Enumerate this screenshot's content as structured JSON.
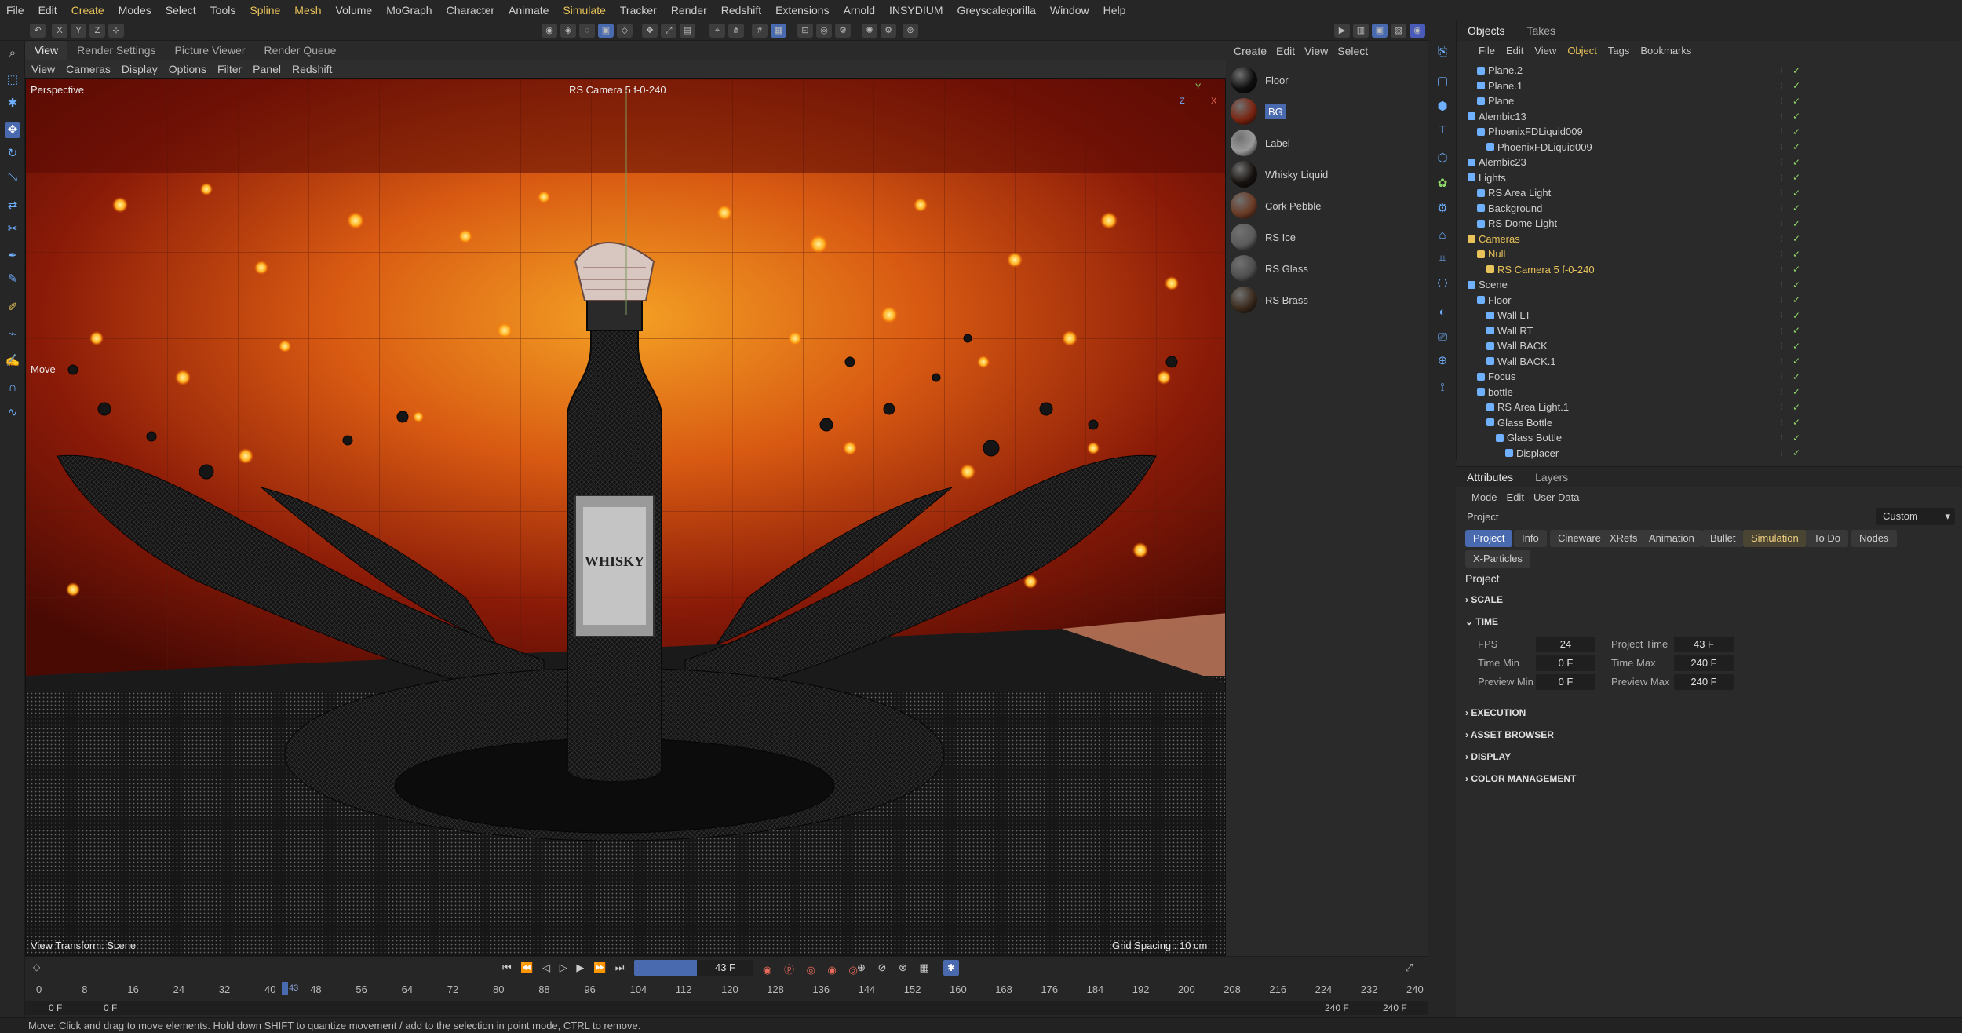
{
  "menu": [
    "File",
    "Edit",
    "Create",
    "Modes",
    "Select",
    "Tools",
    "Spline",
    "Mesh",
    "Volume",
    "MoGraph",
    "Character",
    "Animate",
    "Simulate",
    "Tracker",
    "Render",
    "Redshift",
    "Extensions",
    "Arnold",
    "INSYDIUM",
    "Greyscalegorilla",
    "Window",
    "Help"
  ],
  "menu_highlight": [
    "Create",
    "Spline",
    "Mesh",
    "Simulate"
  ],
  "toolbar_axes": [
    "X",
    "Y",
    "Z"
  ],
  "viewport": {
    "tabs": [
      "View",
      "Render Settings",
      "Picture Viewer",
      "Render Queue"
    ],
    "menu": [
      "View",
      "Cameras",
      "Display",
      "Options",
      "Filter",
      "Panel",
      "Redshift"
    ],
    "perspective_label": "Perspective",
    "camera_label": "RS Camera 5 f-0-240",
    "move_label": "Move",
    "view_transform": "View Transform: Scene",
    "grid_spacing": "Grid Spacing : 10 cm",
    "label_text_1": "WHISKY",
    "axis_y": "Y",
    "axis_x": "X",
    "axis_z": "Z"
  },
  "materials": {
    "menu": [
      "Create",
      "Edit",
      "View",
      "Select"
    ],
    "items": [
      {
        "name": "Floor",
        "color": "#0e0e0e"
      },
      {
        "name": "BG",
        "color": "#7a2410"
      },
      {
        "name": "Label",
        "color": "#9a9a9a"
      },
      {
        "name": "Whisky Liquid",
        "color": "#171210"
      },
      {
        "name": "Cork Pebble",
        "color": "#6a3a24"
      },
      {
        "name": "RS Ice",
        "color": "#5a5a5a"
      },
      {
        "name": "RS Glass",
        "color": "#4e4e4e"
      },
      {
        "name": "RS Brass",
        "color": "#3a2a1c"
      }
    ]
  },
  "objects": {
    "tabs": [
      "Objects",
      "Takes"
    ],
    "menu": [
      "File",
      "Edit",
      "View",
      "Object",
      "Tags",
      "Bookmarks"
    ],
    "rows": [
      {
        "name": "Plane.2",
        "indent": 1,
        "hl": false
      },
      {
        "name": "Plane.1",
        "indent": 1,
        "hl": false
      },
      {
        "name": "Plane",
        "indent": 1,
        "hl": false
      },
      {
        "name": "Alembic13",
        "indent": 0,
        "hl": false
      },
      {
        "name": "PhoenixFDLiquid009",
        "indent": 1,
        "hl": false
      },
      {
        "name": "PhoenixFDLiquid009",
        "indent": 2,
        "hl": false
      },
      {
        "name": "Alembic23",
        "indent": 0,
        "hl": false
      },
      {
        "name": "Lights",
        "indent": 0,
        "hl": false
      },
      {
        "name": "RS Area Light",
        "indent": 1,
        "hl": false
      },
      {
        "name": "Background",
        "indent": 1,
        "hl": false
      },
      {
        "name": "RS Dome Light",
        "indent": 1,
        "hl": false
      },
      {
        "name": "Cameras",
        "indent": 0,
        "hl": true
      },
      {
        "name": "Null",
        "indent": 1,
        "hl": true
      },
      {
        "name": "RS Camera 5 f-0-240",
        "indent": 2,
        "hl": true
      },
      {
        "name": "Scene",
        "indent": 0,
        "hl": false
      },
      {
        "name": "Floor",
        "indent": 1,
        "hl": false
      },
      {
        "name": "Wall LT",
        "indent": 2,
        "hl": false
      },
      {
        "name": "Wall RT",
        "indent": 2,
        "hl": false
      },
      {
        "name": "Wall BACK",
        "indent": 2,
        "hl": false
      },
      {
        "name": "Wall BACK.1",
        "indent": 2,
        "hl": false
      },
      {
        "name": "Focus",
        "indent": 1,
        "hl": false
      },
      {
        "name": "bottle",
        "indent": 1,
        "hl": false
      },
      {
        "name": "RS Area Light.1",
        "indent": 2,
        "hl": false
      },
      {
        "name": "Glass Bottle",
        "indent": 2,
        "hl": false
      },
      {
        "name": "Glass Bottle",
        "indent": 3,
        "hl": false
      },
      {
        "name": "Displacer",
        "indent": 4,
        "hl": false
      }
    ]
  },
  "attributes": {
    "tabs": [
      "Attributes",
      "Layers"
    ],
    "menu": [
      "Mode",
      "Edit",
      "User Data"
    ],
    "context": "Project",
    "preset": "Custom",
    "btn_tabs": [
      "Project",
      "Info",
      "Cineware",
      "XRefs",
      "Animation",
      "Bullet",
      "Simulation",
      "To Do",
      "Nodes"
    ],
    "btn_tab_row2": "X-Particles",
    "heading": "Project",
    "sections": [
      "SCALE",
      "TIME",
      "EXECUTION",
      "ASSET BROWSER",
      "DISPLAY",
      "COLOR MANAGEMENT"
    ],
    "time": {
      "fps_label": "FPS",
      "fps": "24",
      "project_time_label": "Project Time",
      "project_time": "43 F",
      "time_min_label": "Time Min",
      "time_min": "0 F",
      "time_max_label": "Time Max",
      "time_max": "240 F",
      "preview_min_label": "Preview Min",
      "preview_min": "0 F",
      "preview_max_label": "Preview Max",
      "preview_max": "240 F"
    }
  },
  "timeline": {
    "current_frame": "43 F",
    "current_marker": "43",
    "ticks": [
      "0",
      "8",
      "16",
      "24",
      "32",
      "40",
      "48",
      "56",
      "64",
      "72",
      "80",
      "88",
      "96",
      "104",
      "112",
      "120",
      "128",
      "136",
      "144",
      "152",
      "160",
      "168",
      "176",
      "184",
      "192",
      "200",
      "208",
      "216",
      "224",
      "232",
      "240"
    ],
    "start_field": "0 F",
    "start_field2": "0 F",
    "end_field": "240 F",
    "end_field2": "240 F"
  },
  "status": "Move: Click and drag to move elements. Hold down SHIFT to quantize movement / add to the selection in point mode, CTRL to remove."
}
